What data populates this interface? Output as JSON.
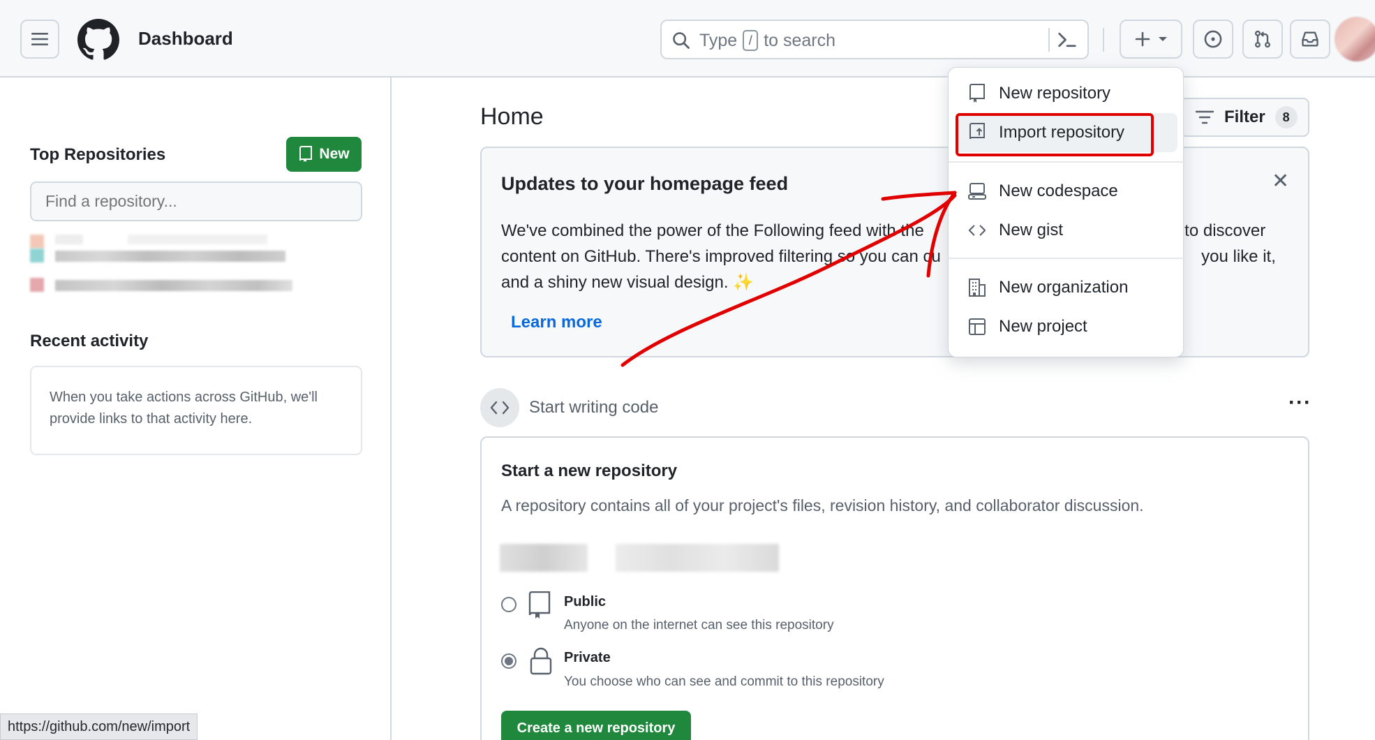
{
  "header": {
    "title": "Dashboard",
    "search": {
      "prefix": "Type",
      "key": "/",
      "suffix": "to search"
    }
  },
  "sidebar": {
    "top_repositories_title": "Top Repositories",
    "new_button_label": "New",
    "find_placeholder": "Find a repository...",
    "recent_activity_title": "Recent activity",
    "recent_activity_text": "When you take actions across GitHub, we'll provide links to that activity here."
  },
  "status_bar": {
    "url": "https://github.com/new/import"
  },
  "main": {
    "home_title": "Home",
    "filter_label": "Filter",
    "filter_count": "8",
    "updates": {
      "title": "Updates to your homepage feed",
      "body_part1": "We've combined the power of the Following feed with the",
      "body_part2": "e to discover content on GitHub. There's improved filtering so you can cu",
      "body_part3": "you like it, and a shiny new visual design.",
      "sparkle": "✨",
      "learn_more": "Learn more"
    },
    "start_writing": "Start writing code",
    "new_repo": {
      "title": "Start a new repository",
      "description": "A repository contains all of your project's files, revision history, and collaborator discussion.",
      "public_label": "Public",
      "public_desc": "Anyone on the internet can see this repository",
      "private_label": "Private",
      "private_desc": "You choose who can see and commit to this repository",
      "selected_visibility": "Private",
      "create_button": "Create a new repository"
    }
  },
  "dropdown": {
    "items": [
      {
        "label": "New repository",
        "icon": "repo-icon"
      },
      {
        "label": "Import repository",
        "icon": "repo-push-icon"
      },
      {
        "label": "New codespace",
        "icon": "codespaces-icon"
      },
      {
        "label": "New gist",
        "icon": "code-icon"
      },
      {
        "label": "New organization",
        "icon": "organization-icon"
      },
      {
        "label": "New project",
        "icon": "table-icon"
      }
    ],
    "highlighted": "Import repository"
  },
  "colors": {
    "primary_button": "#1f883d",
    "link": "#0969da",
    "annotation": "#e00000"
  }
}
